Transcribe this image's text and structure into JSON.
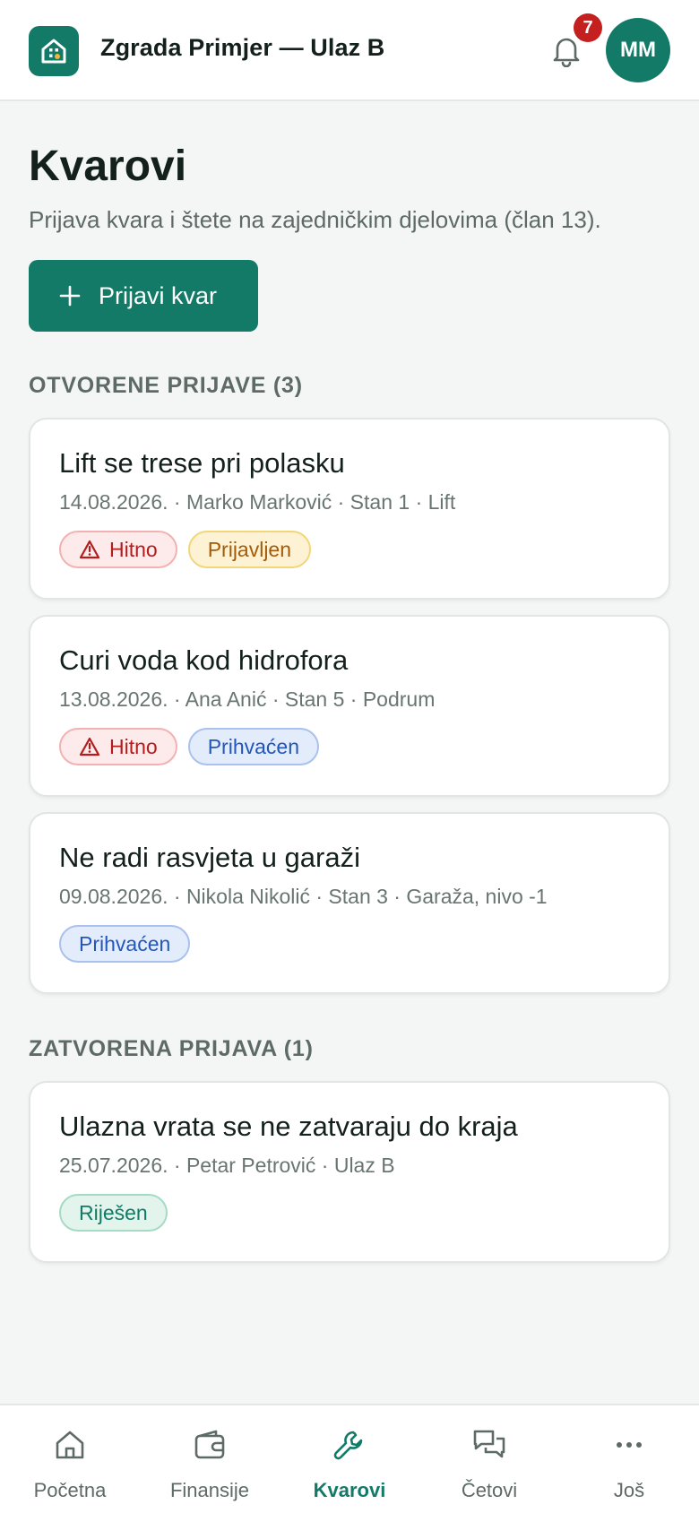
{
  "header": {
    "app_title": "Zgrada Primjer — Ulaz B",
    "notification_count": "7",
    "avatar_initials": "MM"
  },
  "page": {
    "title": "Kvarovi",
    "subtitle": "Prijava kvara i štete na zajedničkim djelovima (član 13).",
    "report_button_label": "Prijavi kvar"
  },
  "open_section": {
    "label": "OTVORENE PRIJAVE (3)",
    "items": [
      {
        "title": "Lift se trese pri polasku",
        "meta": "14.08.2026. · Marko Marković · Stan 1 · Lift",
        "tags": [
          "Hitno",
          "Prijavljen"
        ]
      },
      {
        "title": "Curi voda kod hidrofora",
        "meta": "13.08.2026. · Ana Anić · Stan 5 · Podrum",
        "tags": [
          "Hitno",
          "Prihvaćen"
        ]
      },
      {
        "title": "Ne radi rasvjeta u garaži",
        "meta": "09.08.2026. · Nikola Nikolić · Stan 3 · Garaža, nivo -1",
        "tags": [
          "Prihvaćen"
        ]
      }
    ]
  },
  "closed_section": {
    "label": "ZATVORENA PRIJAVA (1)",
    "items": [
      {
        "title": "Ulazna vrata se ne zatvaraju do kraja",
        "meta": "25.07.2026. · Petar Petrović · Ulaz B",
        "tags": [
          "Riješen"
        ]
      }
    ]
  },
  "bottom_nav": {
    "items": [
      {
        "label": "Početna",
        "icon": "home-icon"
      },
      {
        "label": "Finansije",
        "icon": "wallet-icon"
      },
      {
        "label": "Kvarovi",
        "icon": "wrench-icon",
        "active": true
      },
      {
        "label": "Četovi",
        "icon": "chat-icon"
      },
      {
        "label": "Još",
        "icon": "more-icon"
      }
    ]
  },
  "colors": {
    "primary": "#137a67",
    "urgent": "#b31d1d",
    "badge": "#c4201f"
  }
}
